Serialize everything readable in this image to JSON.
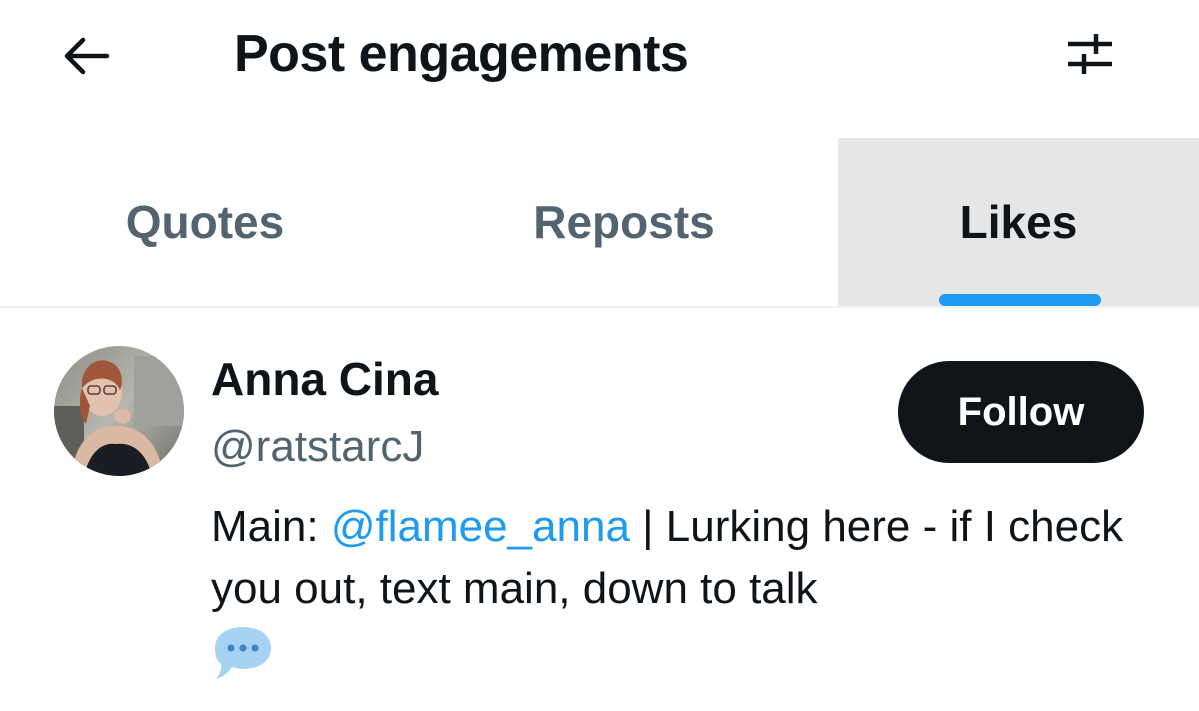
{
  "header": {
    "back_icon": "arrow-left-icon",
    "title": "Post engagements",
    "filter_icon": "sliders-icon"
  },
  "tabs": [
    {
      "label": "Quotes",
      "selected": false
    },
    {
      "label": "Reposts",
      "selected": false
    },
    {
      "label": "Likes",
      "selected": true
    }
  ],
  "colors": {
    "accent": "#1d9bf0",
    "text_primary": "#0f1419",
    "text_secondary": "#536471",
    "selected_tab_bg": "#e6e6e6",
    "follow_bg": "#0f1419"
  },
  "user": {
    "display_name": "Anna Cina",
    "handle": "@ratstarcJ",
    "follow_label": "Follow",
    "bio": {
      "prefix": "Main: ",
      "mention": "@flamee_anna",
      "rest": " | Lurking here - if I check you out, text main, down to talk",
      "emoji": "speech-balloon-emoji"
    }
  }
}
